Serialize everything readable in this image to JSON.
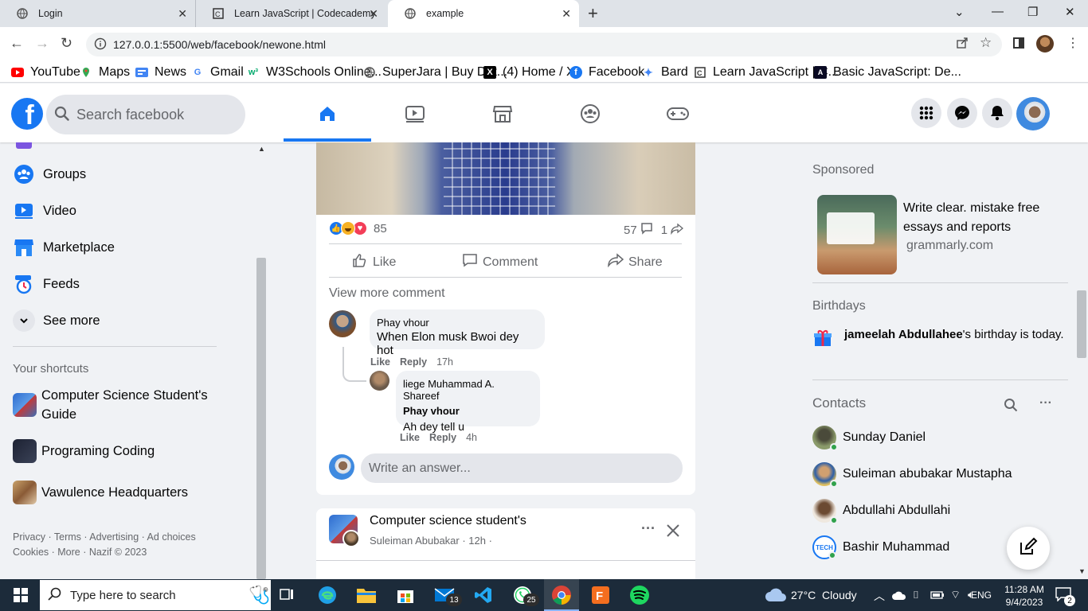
{
  "browser": {
    "tabs": [
      {
        "title": "Login"
      },
      {
        "title": "Learn JavaScript | Codecademy"
      },
      {
        "title": "example"
      }
    ],
    "new_tab": "+",
    "url": "127.0.0.1:5500/web/facebook/newone.html",
    "bookmarks": [
      {
        "label": "YouTube"
      },
      {
        "label": "Maps"
      },
      {
        "label": "News"
      },
      {
        "label": "Gmail"
      },
      {
        "label": "W3Schools Online..."
      },
      {
        "label": "SuperJara | Buy Dat..."
      },
      {
        "label": "(4) Home / X"
      },
      {
        "label": "Facebook"
      },
      {
        "label": "Bard"
      },
      {
        "label": "Learn JavaScript | C..."
      },
      {
        "label": "Basic JavaScript: De..."
      }
    ]
  },
  "header": {
    "search_placeholder": "Search facebook"
  },
  "sidebar": {
    "items": [
      {
        "label": "Groups"
      },
      {
        "label": "Video"
      },
      {
        "label": "Marketplace"
      },
      {
        "label": "Feeds"
      },
      {
        "label": "See more"
      }
    ],
    "shortcuts_title": "Your shortcuts",
    "shortcuts": [
      {
        "label": "Computer Science Student's Guide"
      },
      {
        "label": "Programing Coding"
      },
      {
        "label": "Vawulence Headquarters"
      }
    ],
    "footer_line1": "Privacy · Terms · Advertising · Ad choices",
    "footer_line2": "Cookies · More · Nazif © 2023"
  },
  "post": {
    "reactions_count": "85",
    "comments_count": "57",
    "shares_count": "1",
    "like_label": "Like",
    "comment_label": "Comment",
    "share_label": "Share",
    "view_more": "View more comment",
    "comments": [
      {
        "author": "Phay vhour",
        "text": "When Elon musk Bwoi dey hot",
        "like": "Like",
        "reply": "Reply",
        "time": "17h"
      },
      {
        "author": "liege Muhammad A. Shareef",
        "mention": "Phay vhour",
        "text": "Ah dey tell u",
        "like": "Like",
        "reply": "Reply",
        "time": "4h"
      }
    ],
    "write_placeholder": "Write an answer..."
  },
  "post2": {
    "group": "Computer science student's",
    "author_line": "Suleiman Abubakar · 12h ·",
    "more": "···"
  },
  "right": {
    "sponsored_title": "Sponsored",
    "ad_text": "Write clear. mistake free essays and reports",
    "ad_domain": "grammarly.com",
    "birthdays_title": "Birthdays",
    "birthday_name": "jameelah Abdullahee",
    "birthday_rest": "'s birthday is today.",
    "contacts_title": "Contacts",
    "contacts": [
      {
        "name": "Sunday Daniel"
      },
      {
        "name": "Suleiman abubakar Mustapha"
      },
      {
        "name": "Abdullahi Abdullahi"
      },
      {
        "name": "Bashir Muhammad"
      }
    ]
  },
  "taskbar": {
    "search_text": "Type here to search",
    "weather": "27°C  Cloudy",
    "lang": "ENG",
    "time": "11:28 AM",
    "date": "9/4/2023",
    "mail_badge": "13",
    "whatsapp_badge": "25",
    "notif_badge": "2"
  },
  "colors": {
    "fb_blue": "#1877f2",
    "online_green": "#31a24c"
  }
}
